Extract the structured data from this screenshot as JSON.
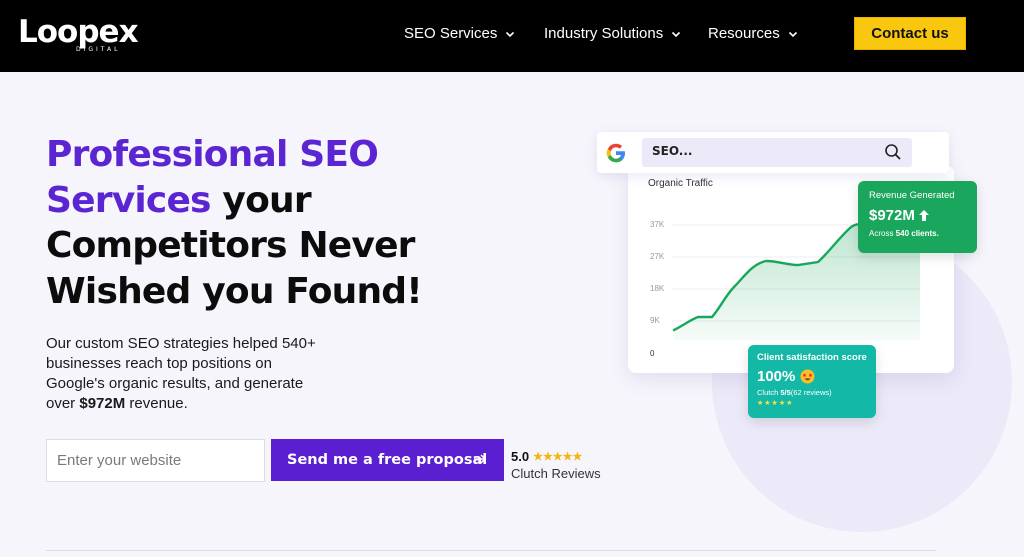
{
  "header": {
    "logo_text": "Loopex",
    "logo_sub": "DIGITAL",
    "nav": [
      {
        "label": "SEO Services"
      },
      {
        "label": "Industry Solutions"
      },
      {
        "label": "Resources"
      }
    ],
    "cta_label": "Contact us"
  },
  "hero": {
    "title_line1_purple": "Professional SEO",
    "title_line2_purple": "Services",
    "title_line2_rest": " your",
    "title_line3": "Competitors Never",
    "title_line4": "Wished you Found!",
    "desc_part1": "Our custom SEO strategies helped 540+ businesses reach top positions on Google's organic results, and generate over ",
    "desc_bold": "$972M",
    "desc_part2": " revenue.",
    "input_placeholder": "Enter your website",
    "submit_label": "Send me a free proposal",
    "rating_value": "5.0",
    "rating_stars": "★★★★★",
    "rating_label": "Clutch Reviews"
  },
  "illustration": {
    "search_text": "SEO...",
    "chart": {
      "title": "Organic Traffic",
      "y_ticks": [
        "37K",
        "27K",
        "18K",
        "9K",
        "0"
      ]
    },
    "revenue_card": {
      "label": "Revenue Generated",
      "value": "$972M",
      "sub_prefix": "Across ",
      "sub_bold": "540 clients."
    },
    "satisfaction_card": {
      "label": "Client satisfaction score",
      "value": "100%",
      "sub_prefix": "Clutch ",
      "sub_bold": "5/5",
      "sub_suffix": "(62 reviews)",
      "stars": "★★★★★"
    }
  },
  "colors": {
    "brand_purple": "#5b25d2",
    "cta_yellow": "#f9c80e",
    "revenue_green": "#1aa65c",
    "satisfaction_teal": "#14b8a6"
  }
}
